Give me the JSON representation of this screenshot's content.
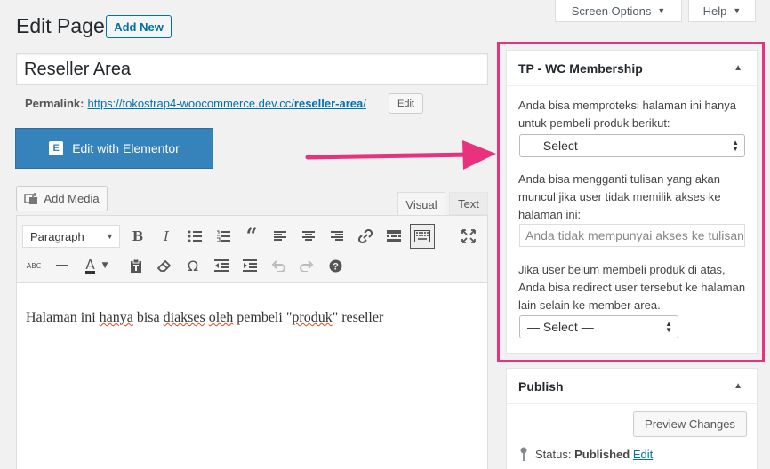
{
  "header": {
    "title": "Edit Page",
    "add_new": "Add New",
    "screen_options": "Screen Options",
    "help": "Help"
  },
  "post": {
    "title": "Reseller Area",
    "permalink_label": "Permalink:",
    "permalink_base": "https://tokostrap4-woocommerce.dev.cc/",
    "permalink_slug": "reseller-area",
    "permalink_end": "/",
    "permalink_edit": "Edit"
  },
  "elementor": {
    "label": "Edit with Elementor",
    "icon_letter": "E"
  },
  "editor": {
    "add_media": "Add Media",
    "tab_visual": "Visual",
    "tab_text": "Text",
    "format_select": "Paragraph",
    "content": {
      "p1": "Halaman ini ",
      "w1": "hanya",
      "p2": " bisa ",
      "w2": "diakses",
      "p3": " ",
      "w3": "oleh",
      "p4": " pembeli \"",
      "w4": "produk",
      "p5": "\" reseller"
    }
  },
  "membership": {
    "title": "TP - WC Membership",
    "text1": "Anda bisa memproteksi halaman ini hanya untuk pembeli produk berikut:",
    "select1": "— Select —",
    "text2": "Anda bisa mengganti tulisan yang akan muncul jika user tidak memilik akses ke halaman ini:",
    "input_placeholder": "Anda tidak mempunyai akses ke tulisan ini",
    "text3": "Jika user belum membeli produk di atas, Anda bisa redirect user tersebut ke halaman lain selain ke member area.",
    "select2": "— Select —"
  },
  "publish": {
    "title": "Publish",
    "preview": "Preview Changes",
    "status_label": "Status:",
    "status_value": "Published",
    "status_edit": "Edit"
  },
  "colors": {
    "accent": "#0073aa",
    "elementor": "#3682ba",
    "highlight": "#e8327d"
  }
}
